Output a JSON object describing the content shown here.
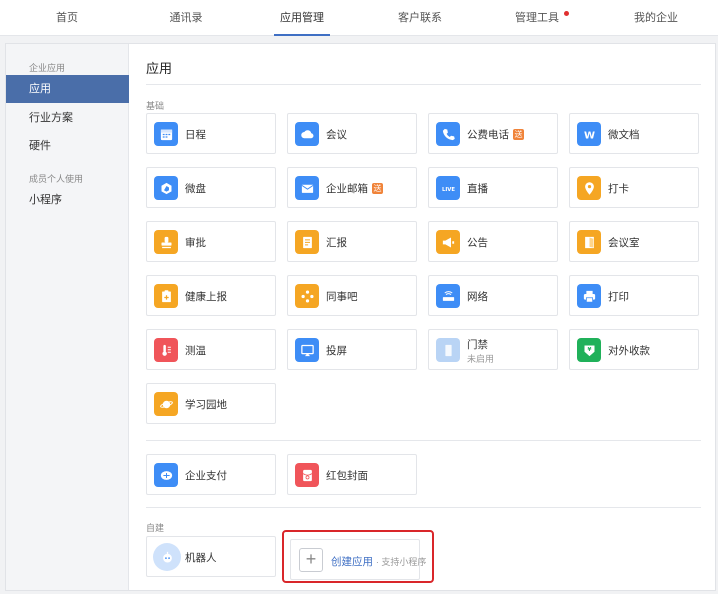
{
  "nav": {
    "tabs": [
      "首页",
      "通讯录",
      "应用管理",
      "客户联系",
      "管理工具",
      "我的企业"
    ],
    "active_index": 2
  },
  "sidebar": {
    "group1": "企业应用",
    "items": [
      "应用",
      "行业方案",
      "硬件"
    ],
    "group2": "成员个人使用",
    "item_mini": "小程序"
  },
  "main": {
    "title": "应用",
    "section_basic": "基础",
    "section_custom": "自建",
    "apps": [
      {
        "label": "日程",
        "icon": "calendar-icon",
        "color": "#3e8df6"
      },
      {
        "label": "会议",
        "icon": "cloud-icon",
        "color": "#3e8df6"
      },
      {
        "label": "公费电话",
        "icon": "phone-icon",
        "color": "#3e8df6",
        "badge": "送"
      },
      {
        "label": "微文档",
        "icon": "w-doc-icon",
        "color": "#3e8df6"
      },
      {
        "label": "微盘",
        "icon": "drive-icon",
        "color": "#3e8df6"
      },
      {
        "label": "企业邮箱",
        "icon": "mail-icon",
        "color": "#3e8df6",
        "badge": "送"
      },
      {
        "label": "直播",
        "icon": "live-icon",
        "color": "#3e8df6"
      },
      {
        "label": "打卡",
        "icon": "location-icon",
        "color": "#f5a623"
      },
      {
        "label": "审批",
        "icon": "stamp-icon",
        "color": "#f5a623"
      },
      {
        "label": "汇报",
        "icon": "report-icon",
        "color": "#f5a623"
      },
      {
        "label": "公告",
        "icon": "megaphone-icon",
        "color": "#f5a623"
      },
      {
        "label": "会议室",
        "icon": "door-icon",
        "color": "#f5a623"
      },
      {
        "label": "健康上报",
        "icon": "health-icon",
        "color": "#f5a623"
      },
      {
        "label": "同事吧",
        "icon": "colleague-icon",
        "color": "#f5a623"
      },
      {
        "label": "网络",
        "icon": "router-icon",
        "color": "#3e8df6"
      },
      {
        "label": "打印",
        "icon": "printer-icon",
        "color": "#3e8df6"
      },
      {
        "label": "测温",
        "icon": "thermometer-icon",
        "color": "#f0555a"
      },
      {
        "label": "投屏",
        "icon": "screencast-icon",
        "color": "#3e8df6"
      },
      {
        "label": "门禁",
        "sub": "未启用",
        "icon": "access-icon",
        "color": "#b9d4f5"
      },
      {
        "label": "对外收款",
        "icon": "payment-icon",
        "color": "#20b15a"
      },
      {
        "label": "学习园地",
        "icon": "planet-icon",
        "color": "#f5a623"
      }
    ],
    "apps2": [
      {
        "label": "企业支付",
        "icon": "pay-icon",
        "color": "#3e8df6"
      },
      {
        "label": "红包封面",
        "icon": "redpacket-icon",
        "color": "#f0555a"
      }
    ],
    "robot": {
      "label": "机器人",
      "icon": "robot-icon"
    },
    "create": {
      "label": "创建应用",
      "hint": "· 支持小程序"
    }
  }
}
